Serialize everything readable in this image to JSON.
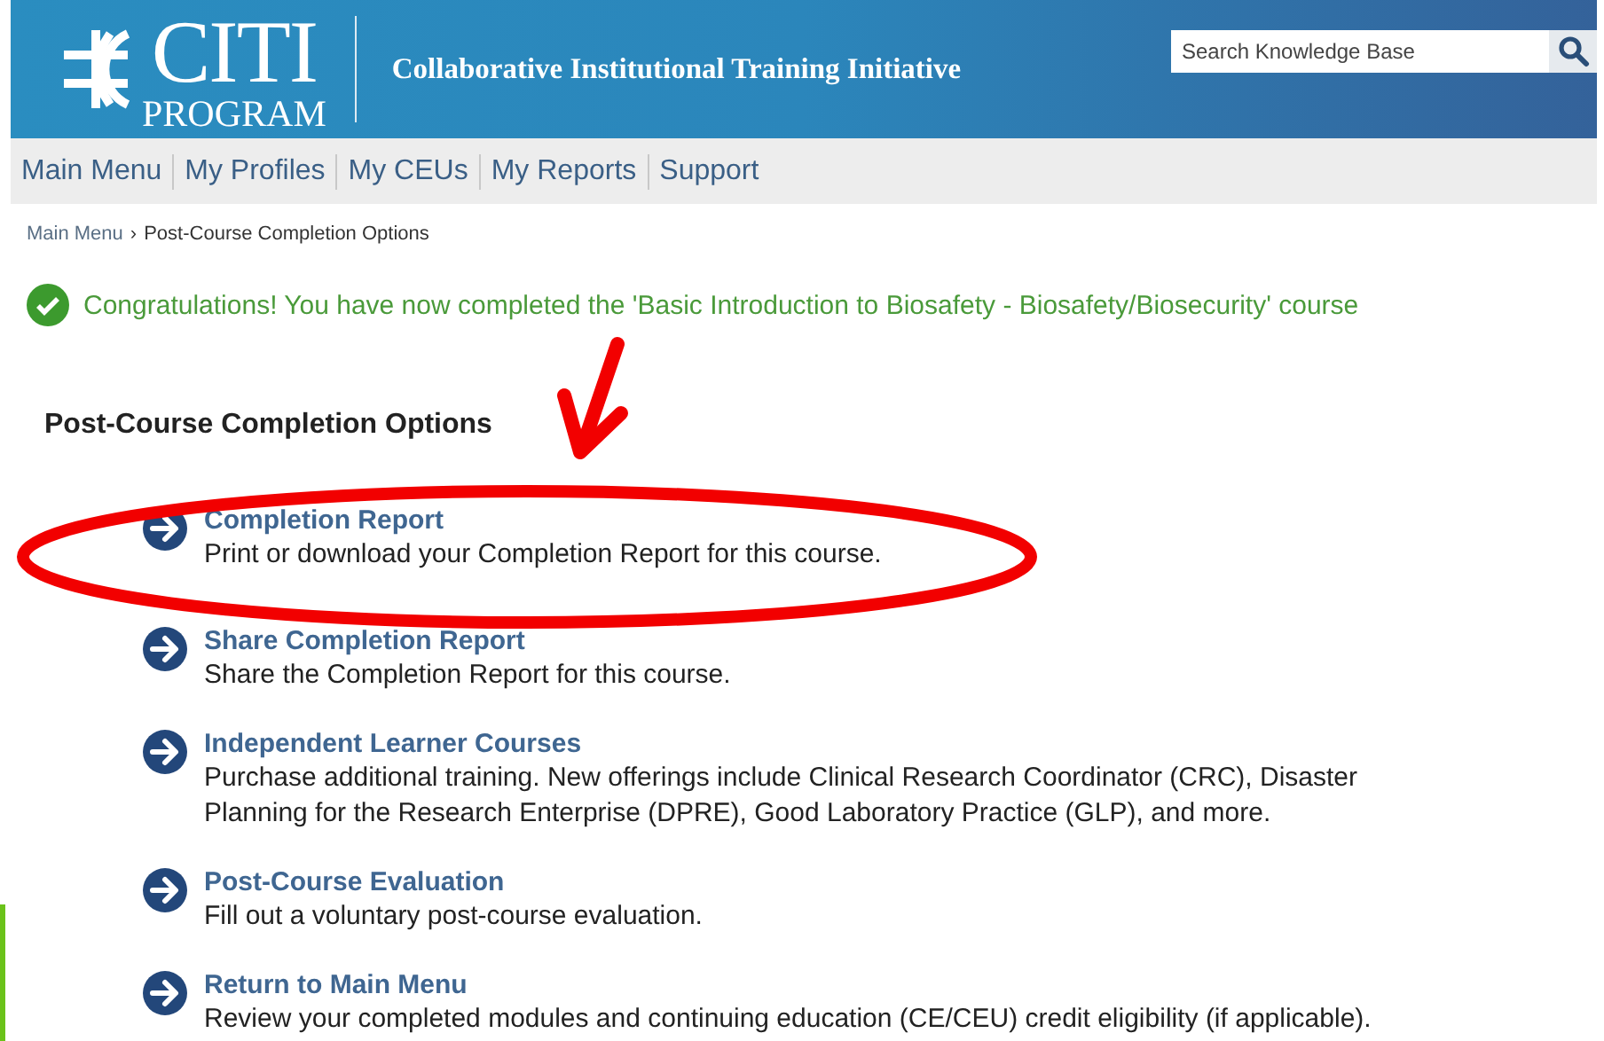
{
  "header": {
    "logo_top": "CITI",
    "logo_bottom": "PROGRAM",
    "title": "Collaborative Institutional Training Initiative",
    "search": {
      "placeholder": "Search Knowledge Base"
    }
  },
  "nav": [
    "Main Menu",
    "My Profiles",
    "My CEUs",
    "My Reports",
    "Support"
  ],
  "breadcrumb": {
    "link": "Main Menu",
    "separator": "›",
    "current": "Post-Course Completion Options"
  },
  "success_message": "Congratulations! You have now completed the 'Basic Introduction to Biosafety - Biosafety/Biosecurity' course",
  "section_title": "Post-Course Completion Options",
  "options": [
    {
      "title": "Completion Report",
      "description": "Print or download your Completion Report for this course."
    },
    {
      "title": "Share Completion Report",
      "description": "Share the Completion Report for this course."
    },
    {
      "title": "Independent Learner Courses",
      "description": "Purchase additional training. New offerings include Clinical Research Coordinator (CRC), Disaster Planning for the Research Enterprise (DPRE), Good Laboratory Practice (GLP), and more."
    },
    {
      "title": "Post-Course Evaluation",
      "description": "Fill out a voluntary post-course evaluation."
    },
    {
      "title": "Return to Main Menu",
      "description": "Review your completed modules and continuing education (CE/CEU) credit eligibility (if applicable)."
    }
  ]
}
